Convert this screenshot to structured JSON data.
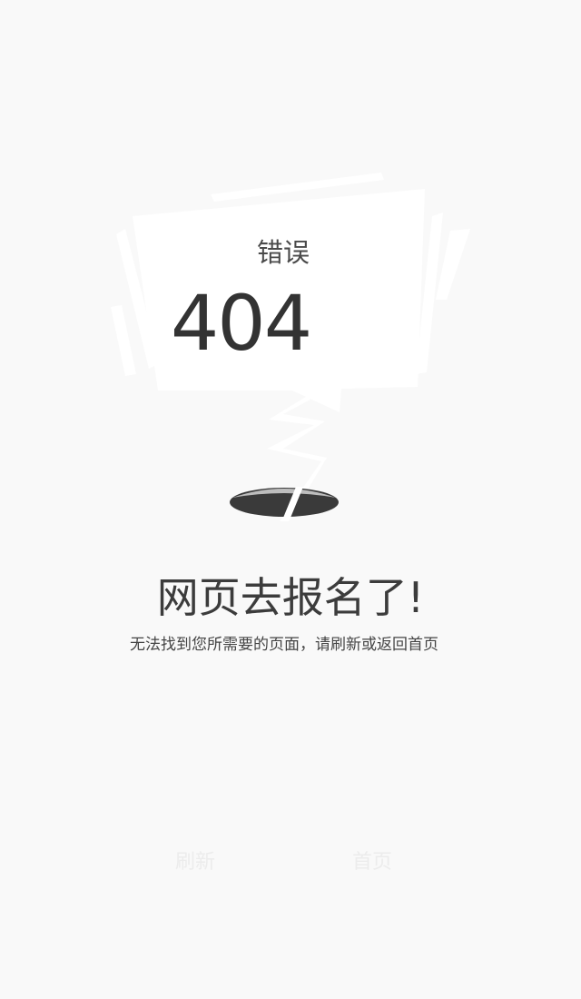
{
  "sign": {
    "label": "错误",
    "code": "404"
  },
  "message": {
    "title": "网页去报名了!",
    "description": "无法找到您所需要的页面，请刷新或返回首页"
  },
  "actions": {
    "refresh_label": "刷新",
    "home_label": "首页"
  },
  "colors": {
    "background": "#f9f9f9",
    "sign_paper": "#ffffff",
    "hole": "#3a3a3a",
    "text_dark": "#333333",
    "button_text": "#ececec"
  },
  "icons": {
    "illustration": "broken-sign-illustration",
    "hole": "hole-icon"
  }
}
